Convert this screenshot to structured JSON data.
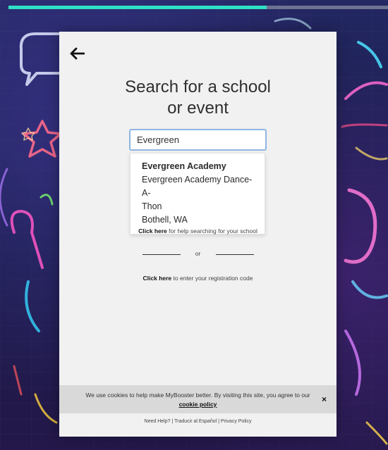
{
  "progress": {
    "percent": 68
  },
  "card": {
    "title_line1": "Search for a school",
    "title_line2": "or event"
  },
  "search": {
    "value": "Evergreen",
    "placeholder": ""
  },
  "result": {
    "name": "Evergreen Academy",
    "event_line1": "Evergreen Academy Dance-A-",
    "event_line2": "Thon",
    "location": "Bothell, WA"
  },
  "help": {
    "link_text": "Click here",
    "rest_text": " for help searching for your school"
  },
  "divider": {
    "or_text": "or"
  },
  "registration": {
    "link_text": "Click here",
    "rest_text": " to enter your registration code"
  },
  "cookie": {
    "message": "We use cookies to help make MyBooster better. By visiting this site, you agree to our",
    "policy_link": "cookie policy",
    "close": "×"
  },
  "footer": {
    "need_help": "Need Help?",
    "sep1": " | ",
    "translate": "Traducir al Español",
    "sep2": " | ",
    "privacy": "Privacy Policy"
  },
  "colors": {
    "progress_fill": "#2fe0c4",
    "progress_track": "#6d7390",
    "card_bg": "#f1f1f1",
    "input_border": "#8fb6e0"
  },
  "icons": {
    "back": "left-arrow-icon"
  }
}
